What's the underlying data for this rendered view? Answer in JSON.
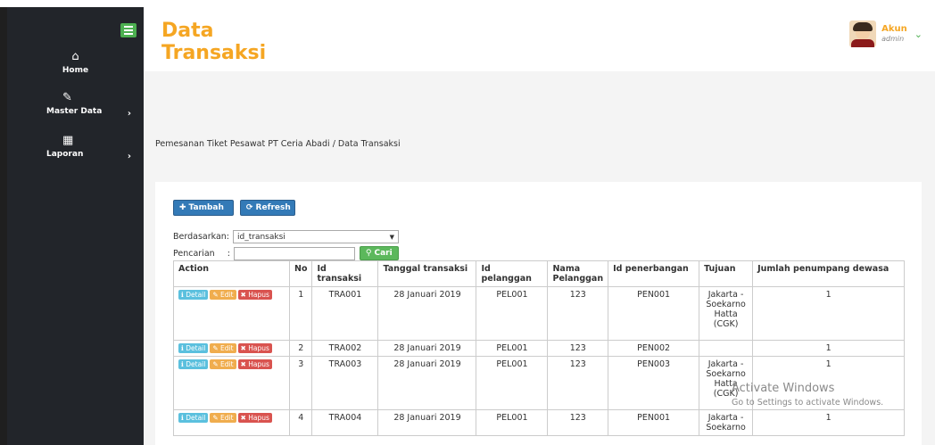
{
  "sidebar": {
    "items": [
      {
        "label": "Home",
        "icon": "home-icon"
      },
      {
        "label": "Master Data",
        "icon": "edit-icon"
      },
      {
        "label": "Laporan",
        "icon": "calendar-icon"
      }
    ]
  },
  "header": {
    "title": "Data Transaksi",
    "account_name": "Akun",
    "account_role": "admin"
  },
  "breadcrumb": "Pemesanan Tiket Pesawat PT Ceria Abadi / Data Transaksi",
  "toolbar": {
    "add_label": "Tambah",
    "refresh_label": "Refresh"
  },
  "filter": {
    "by_label": "Berdasarkan:",
    "by_value": "id_transaksi",
    "search_label": "Pencarian",
    "search_value": "",
    "search_button": "Cari"
  },
  "table": {
    "columns": [
      "Action",
      "No",
      "Id transaksi",
      "Tanggal transaksi",
      "Id pelanggan",
      "Nama Pelanggan",
      "Id penerbangan",
      "Tujuan",
      "Jumlah penumpang dewasa"
    ],
    "actions": {
      "detail": "Detail",
      "edit": "Edit",
      "hapus": "Hapus"
    },
    "rows": [
      {
        "no": "1",
        "id_transaksi": "TRA001",
        "tanggal": "28 Januari 2019",
        "id_pelanggan": "PEL001",
        "nama": "123",
        "id_penerbangan": "PEN001",
        "tujuan": "Jakarta - Soekarno Hatta (CGK)",
        "dewasa": "1"
      },
      {
        "no": "2",
        "id_transaksi": "TRA002",
        "tanggal": "28 Januari 2019",
        "id_pelanggan": "PEL001",
        "nama": "123",
        "id_penerbangan": "PEN002",
        "tujuan": "",
        "dewasa": "1"
      },
      {
        "no": "3",
        "id_transaksi": "TRA003",
        "tanggal": "28 Januari 2019",
        "id_pelanggan": "PEL001",
        "nama": "123",
        "id_penerbangan": "PEN003",
        "tujuan": "Jakarta - Soekarno Hatta (CGK)",
        "dewasa": "1"
      },
      {
        "no": "4",
        "id_transaksi": "TRA004",
        "tanggal": "28 Januari 2019",
        "id_pelanggan": "PEL001",
        "nama": "123",
        "id_penerbangan": "PEN001",
        "tujuan": "Jakarta - Soekarno",
        "dewasa": "1"
      }
    ]
  },
  "watermark": {
    "line1": "Activate Windows",
    "line2": "Go to Settings to activate Windows."
  },
  "colors": {
    "accent": "#f5a623",
    "sidebar_bg": "#22252a",
    "primary_button": "#337ab7",
    "success_button": "#5cb85c"
  }
}
